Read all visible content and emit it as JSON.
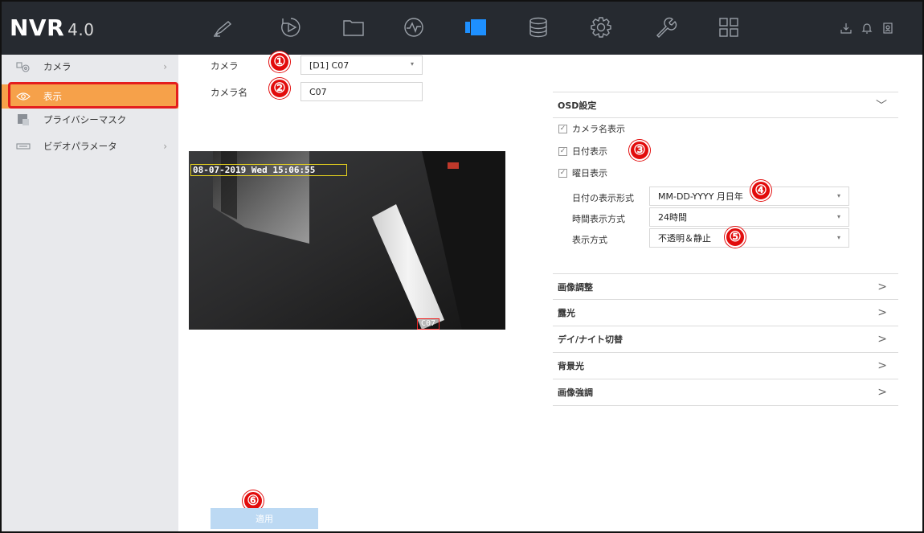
{
  "app": {
    "logo": "NVR",
    "version": "4.0"
  },
  "top_nav": {
    "icons": [
      "live-view-icon",
      "playback-icon",
      "file-management-icon",
      "smart-analysis-icon",
      "camera-icon",
      "storage-icon",
      "system-icon",
      "maintenance-icon",
      "menu-grid-icon"
    ],
    "active": "camera-icon",
    "right_icons": [
      "download-icon",
      "bell-icon",
      "account-icon"
    ]
  },
  "sidebar": {
    "items": [
      {
        "label": "カメラ",
        "icon": "camera-ip-icon",
        "chevron": "›"
      },
      {
        "label": "表示",
        "icon": "eye-icon",
        "active": true
      },
      {
        "label": "プライバシーマスク",
        "icon": "privacy-mask-icon"
      },
      {
        "label": "ビデオパラメータ",
        "icon": "video-param-icon",
        "chevron": "›"
      }
    ]
  },
  "form": {
    "camera_label": "カメラ",
    "camera_value": "[D1] C07",
    "camera_name_label": "カメラ名",
    "camera_name_value": "C07"
  },
  "preview": {
    "osd_datetime": "08-07-2019 Wed 15:06:55",
    "osd_camera_name": "C07"
  },
  "badges": [
    "①",
    "②",
    "③",
    "④",
    "⑤",
    "⑥"
  ],
  "osd_settings": {
    "title": "OSD設定",
    "checkboxes": [
      {
        "label": "カメラ名表示",
        "checked": true
      },
      {
        "label": "日付表示",
        "checked": true
      },
      {
        "label": "曜日表示",
        "checked": true
      }
    ],
    "date_format_label": "日付の表示形式",
    "date_format_value": "MM-DD-YYYY 月日年",
    "time_format_label": "時間表示方式",
    "time_format_value": "24時間",
    "display_mode_label": "表示方式",
    "display_mode_value": "不透明＆静止"
  },
  "sections": [
    {
      "label": "画像調整"
    },
    {
      "label": "露光"
    },
    {
      "label": "デイ/ナイト切替"
    },
    {
      "label": "背景光"
    },
    {
      "label": "画像強調"
    }
  ],
  "apply_label": "適用",
  "colors": {
    "topbar": "#262a30",
    "active_nav": "#1e90ff",
    "sidebar_active": "#f6a14a",
    "highlight_red": "#e41e1e",
    "apply_button": "#bcd9f3"
  }
}
